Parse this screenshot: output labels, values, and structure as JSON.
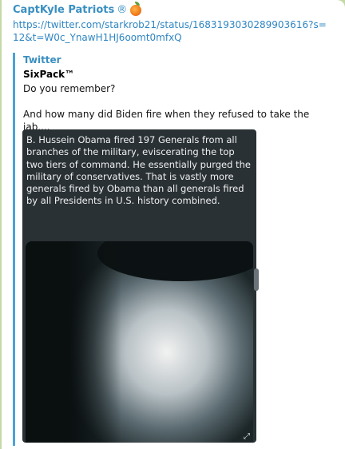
{
  "message": {
    "sender": "CaptKyle Patriots",
    "sender_mark": "®",
    "sender_emoji_icon": "peach-icon",
    "link": "https://twitter.com/starkrob21/status/1683193030289903616?s=12&t=W0c_YnawH1HJ6oomt0mfxQ"
  },
  "preview": {
    "site": "Twitter",
    "title": "SixPack™",
    "description": "Do you remember?\n\nAnd how many did Biden fire when they refused to take the jab....",
    "image_text": "B. Hussein Obama fired 197 Generals from all branches of the military, eviscerating the top two tiers of command. He essentially purged the military of conservatives. That is vastly more generals fired by Obama than all generals fired by all Presidents in U.S. history combined.",
    "expand_glyph": "⤢"
  },
  "colors": {
    "background": "#c5d9a8",
    "accent": "#3a8fc1",
    "preview_bar": "#4ba3d6"
  }
}
